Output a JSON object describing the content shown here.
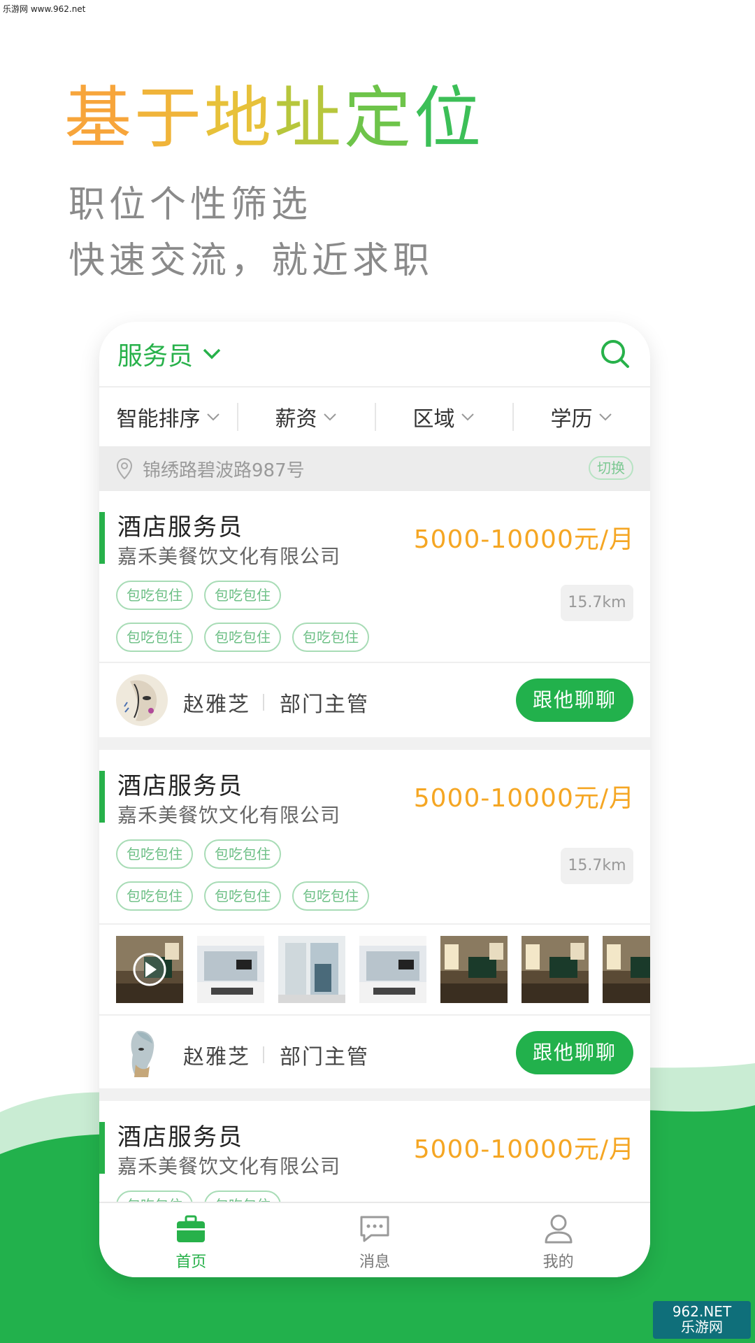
{
  "watermark": "乐游网 www.962.net",
  "hero": {
    "title_chars": [
      {
        "text": "基",
        "color": "#f7a53b"
      },
      {
        "text": "于",
        "color": "#f0b43a"
      },
      {
        "text": "地",
        "color": "#e7c13a"
      },
      {
        "text": "址",
        "color": "#b7c63c"
      },
      {
        "text": "定",
        "color": "#6ec44a"
      },
      {
        "text": "位",
        "color": "#3cbf57"
      }
    ],
    "line1": "职位个性筛选",
    "line2": "快速交流，就近求职"
  },
  "app": {
    "header": {
      "job_label": "服务员"
    },
    "filters": [
      "智能排序",
      "薪资",
      "区域",
      "学历"
    ],
    "location": {
      "address": "锦绣路碧波路987号",
      "switch_label": "切换"
    },
    "cards": [
      {
        "title": "酒店服务员",
        "company": "嘉禾美餐饮文化有限公司",
        "salary": "5000-10000元/月",
        "tags": [
          "包吃包住",
          "包吃包住",
          "包吃包住",
          "包吃包住",
          "包吃包住"
        ],
        "distance": "15.7km",
        "contact_name": "赵雅芝",
        "contact_role": "部门主管",
        "chat_label": "跟他聊聊"
      },
      {
        "title": "酒店服务员",
        "company": "嘉禾美餐饮文化有限公司",
        "salary": "5000-10000元/月",
        "tags": [
          "包吃包住",
          "包吃包住",
          "包吃包住",
          "包吃包住",
          "包吃包住"
        ],
        "distance": "15.7km",
        "contact_name": "赵雅芝",
        "contact_role": "部门主管",
        "chat_label": "跟他聊聊"
      },
      {
        "title": "酒店服务员",
        "company": "嘉禾美餐饮文化有限公司",
        "salary": "5000-10000元/月",
        "tags": [
          "包吃包住",
          "包吃包住"
        ]
      }
    ],
    "tabs": [
      {
        "label": "首页",
        "active": true
      },
      {
        "label": "消息",
        "active": false
      },
      {
        "label": "我的",
        "active": false
      }
    ]
  },
  "badge": {
    "line1": "962.NET",
    "line2": "乐游网"
  },
  "colors": {
    "accent": "#27b14a",
    "salary": "#f5a623",
    "wave": "#22b14c"
  }
}
